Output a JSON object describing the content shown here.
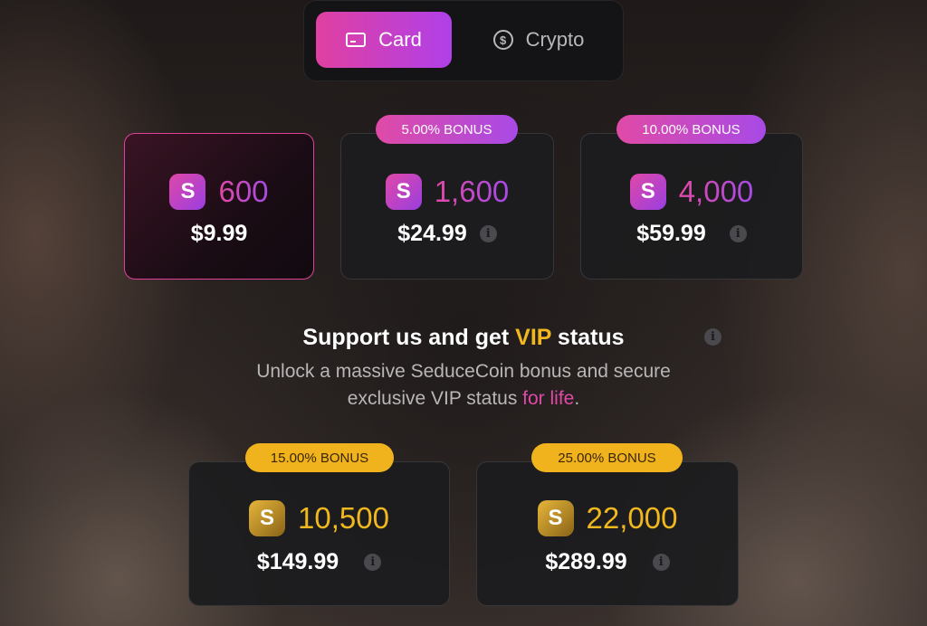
{
  "payment_tabs": [
    {
      "label": "Card",
      "icon": "credit-card-icon",
      "active": true
    },
    {
      "label": "Crypto",
      "icon": "dollar-coin-icon",
      "active": false
    }
  ],
  "coin_letter": "S",
  "info_glyph": "i",
  "standard_packages": [
    {
      "coins": "600",
      "price": "$9.99",
      "bonus": null,
      "selected": true
    },
    {
      "coins": "1,600",
      "price": "$24.99",
      "bonus": "5.00% BONUS",
      "selected": false
    },
    {
      "coins": "4,000",
      "price": "$59.99",
      "bonus": "10.00% BONUS",
      "selected": false
    }
  ],
  "vip": {
    "title_pre": "Support us and get ",
    "title_highlight": "VIP",
    "title_post": " status",
    "desc_line1": "Unlock a massive SeduceCoin bonus and secure",
    "desc_line2_pre": "exclusive VIP status ",
    "desc_line2_highlight": "for life",
    "desc_line2_post": "."
  },
  "vip_packages": [
    {
      "coins": "10,500",
      "price": "$149.99",
      "bonus": "15.00% BONUS"
    },
    {
      "coins": "22,000",
      "price": "$289.99",
      "bonus": "25.00% BONUS"
    }
  ],
  "colors": {
    "accent_pink": "#e04aa6",
    "accent_purple": "#a84ae6",
    "vip_gold": "#f0b81e"
  }
}
